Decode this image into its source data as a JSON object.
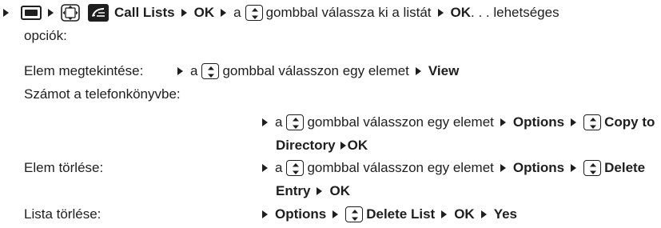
{
  "step": {
    "call_lists": "Call Lists",
    "ok1": "OK",
    "a": "a",
    "gombbal_lista": "gombbal válassza ki a listát",
    "ok2": "OK",
    "lehetseges": ". . . lehetséges",
    "opciok": "opciók:"
  },
  "rows": {
    "view_label": "Elem megtekintése:",
    "view_a": "a",
    "view_text": "gombbal válasszon egy elemet",
    "view_action": "View",
    "copy_label": "Számot a telefonkönyvbe:",
    "copy_a": "a",
    "copy_text": "gombbal válasszon egy elemet",
    "copy_options": "Options",
    "copy_to": "Copy to",
    "copy_directory": "Directory",
    "copy_ok": "OK",
    "del_label": "Elem törlése:",
    "del_a": "a",
    "del_text": "gombbal válasszon egy elemet",
    "del_options": "Options",
    "del_delete": "Delete",
    "del_entry": "Entry",
    "del_ok": "OK",
    "list_label": "Lista törlése:",
    "list_options": "Options",
    "list_delete": "Delete List",
    "list_ok": "OK",
    "list_yes": "Yes"
  },
  "icons": [
    "arrow-icon",
    "menu-key-icon",
    "four-way-nav-icon",
    "phone-list-icon",
    "up-down-nav-icon"
  ]
}
